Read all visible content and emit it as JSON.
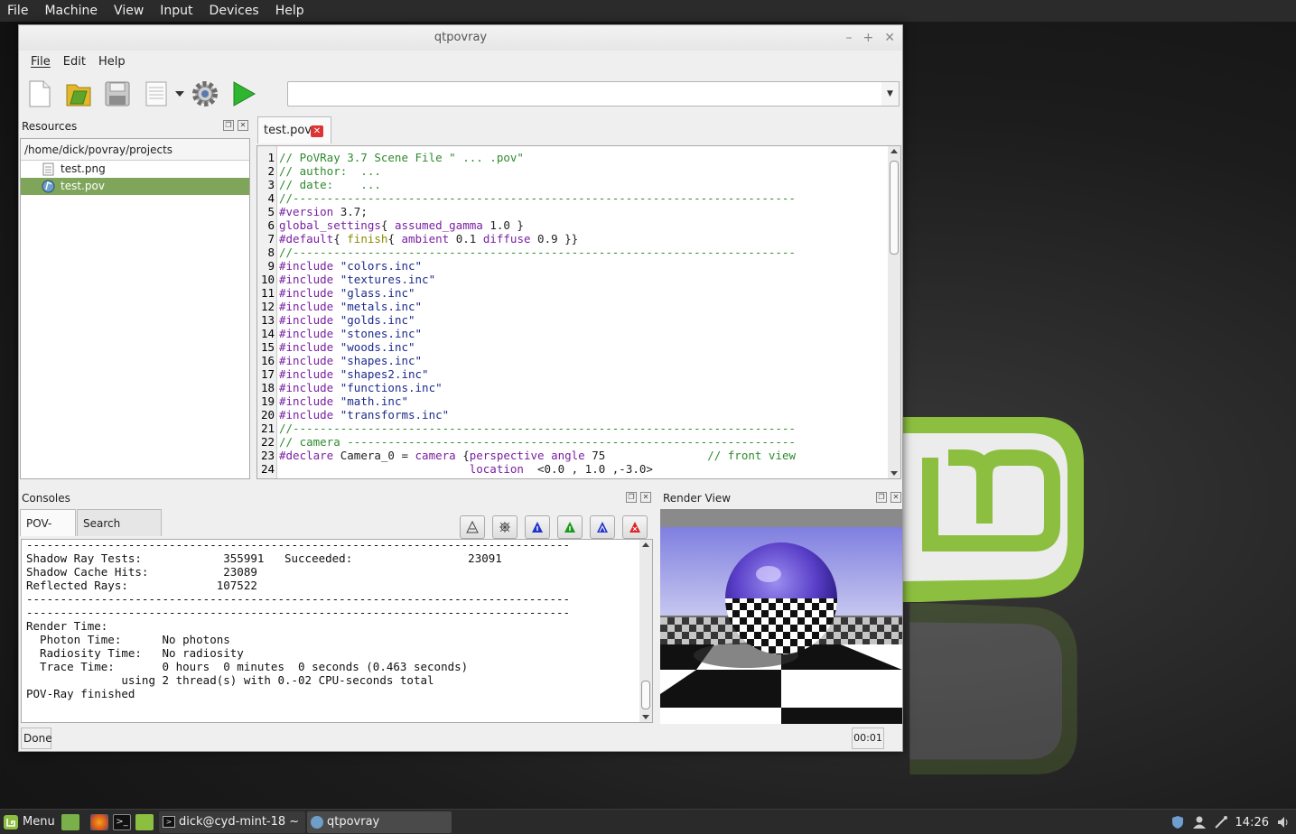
{
  "host_menu": [
    "File",
    "Machine",
    "View",
    "Input",
    "Devices",
    "Help"
  ],
  "window": {
    "title": "qtpovray"
  },
  "app_menu": [
    "File",
    "Edit",
    "Help"
  ],
  "toolbar": {
    "icons": [
      "new-file-icon",
      "open-folder-icon",
      "save-icon",
      "document-icon",
      "dropdown-arrow-icon",
      "settings-gear-icon",
      "run-render-icon"
    ],
    "command_value": ""
  },
  "resources": {
    "title": "Resources",
    "path": "/home/dick/povray/projects",
    "files": [
      {
        "name": "test.png",
        "icon": "text-file-icon",
        "selected": false
      },
      {
        "name": "test.pov",
        "icon": "pov-file-icon",
        "selected": true
      }
    ]
  },
  "editor": {
    "tab": "test.pov",
    "line_numbers": [
      "1",
      "2",
      "3",
      "4",
      "5",
      "6",
      "7",
      "8",
      "9",
      "10",
      "11",
      "12",
      "13",
      "14",
      "15",
      "16",
      "17",
      "18",
      "19",
      "20",
      "21",
      "22",
      "23",
      "24"
    ],
    "lines": [
      "// PoVRay 3.7 Scene File \" ... .pov\"",
      "// author:  ...",
      "// date:    ...",
      "//--------------------------------------------------------------------------",
      "#version 3.7;",
      "global_settings{ assumed_gamma 1.0 }",
      "#default{ finish{ ambient 0.1 diffuse 0.9 }}",
      "//--------------------------------------------------------------------------",
      "#include \"colors.inc\"",
      "#include \"textures.inc\"",
      "#include \"glass.inc\"",
      "#include \"metals.inc\"",
      "#include \"golds.inc\"",
      "#include \"stones.inc\"",
      "#include \"woods.inc\"",
      "#include \"shapes.inc\"",
      "#include \"shapes2.inc\"",
      "#include \"functions.inc\"",
      "#include \"math.inc\"",
      "#include \"transforms.inc\"",
      "//--------------------------------------------------------------------------",
      "// camera ------------------------------------------------------------------",
      "#declare Camera_0 = camera {perspective angle 75               // front view",
      "                            location  <0.0 , 1.0 ,-3.0>"
    ]
  },
  "consoles": {
    "title": "Consoles",
    "tabs": [
      "POV-Ray",
      "Search Results"
    ],
    "output": [
      "--------------------------------------------------------------------------------",
      "Shadow Ray Tests:            355991   Succeeded:                 23091",
      "Shadow Cache Hits:           23089",
      "Reflected Rays:             107522",
      "--------------------------------------------------------------------------------",
      "--------------------------------------------------------------------------------",
      "Render Time:",
      "  Photon Time:      No photons",
      "  Radiosity Time:   No radiosity",
      "  Trace Time:       0 hours  0 minutes  0 seconds (0.463 seconds)",
      "              using 2 thread(s) with 0.-02 CPU-seconds total",
      "POV-Ray finished"
    ]
  },
  "render_view": {
    "title": "Render View"
  },
  "status": {
    "text": "Done",
    "time": "00:01"
  },
  "taskbar": {
    "menu_label": "Menu",
    "tasks": [
      "dick@cyd-mint-18 ~",
      "qtpovray"
    ],
    "clock": "14:26"
  },
  "colors": {
    "selection": "#7fa55a",
    "mint_green": "#8cbf3f",
    "comment": "#2e8b2e",
    "keyword": "#7a1fa2",
    "string": "#1c2b8c"
  }
}
